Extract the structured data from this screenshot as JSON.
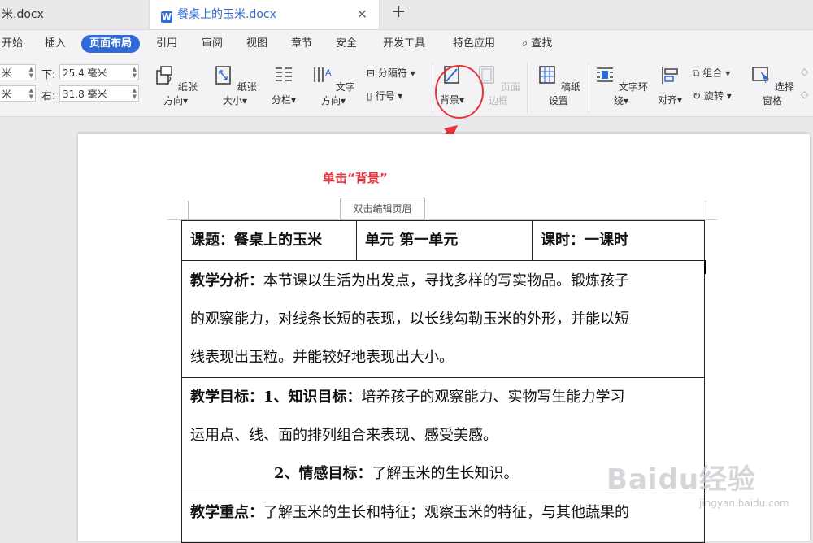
{
  "tabs": [
    {
      "label": "米.docx"
    },
    {
      "label": "餐桌上的玉米.docx",
      "icon": "W"
    }
  ],
  "menu": [
    "开始",
    "插入",
    "页面布局",
    "引用",
    "审阅",
    "视图",
    "章节",
    "安全",
    "开发工具",
    "特色应用"
  ],
  "search_label": "查找",
  "margins": {
    "top_value": "米",
    "left_value": "米",
    "bottom_label": "下:",
    "bottom_value": "25.4 毫米",
    "right_label": "右:",
    "right_value": "31.8 毫米"
  },
  "tools": {
    "orientation": "纸张方向",
    "size": "纸张大小",
    "columns": "分栏",
    "text_direction": "文字方向",
    "separator": "分隔符",
    "line_number": "行号",
    "background": "背景",
    "page_border": "页面边框",
    "grid_paper": "稿纸设置",
    "text_wrap": "文字环绕",
    "align": "对齐",
    "group": "组合",
    "rotate": "旋转",
    "selection_pane": "选择窗格"
  },
  "annotation": "单击“背景”",
  "header_button": "双击编辑页眉",
  "table": {
    "row1": [
      "课题：餐桌上的玉米",
      "单元  第一单元",
      "课时：一课时"
    ],
    "analysis_label": "教学分析：",
    "analysis_lines": [
      "本节课以生活为出发点，寻找多样的写实物品。锻炼孩子",
      "的观察能力，对线条长短的表现，以长线勾勒玉米的外形，并能以短",
      "线表现出玉粒。并能较好地表现出大小。"
    ],
    "goal_label": "教学目标：1、知识目标：",
    "goal_line1": "培养孩子的观察能力、实物写生能力学习",
    "goal_line2": "运用点、线、面的排列组合来表现、感受美感。",
    "emotion_label": "2、情感目标：",
    "emotion_text": "了解玉米的生长知识。",
    "key_label": "教学重点：",
    "key_text": "了解玉米的生长和特征；观察玉米的特征，与其他蔬果的"
  },
  "watermark": "Baidu经验",
  "watermark_sub": "jingyan.baidu.com",
  "colors": {
    "accent": "#2f6bd8",
    "annotation": "#e8323c"
  }
}
